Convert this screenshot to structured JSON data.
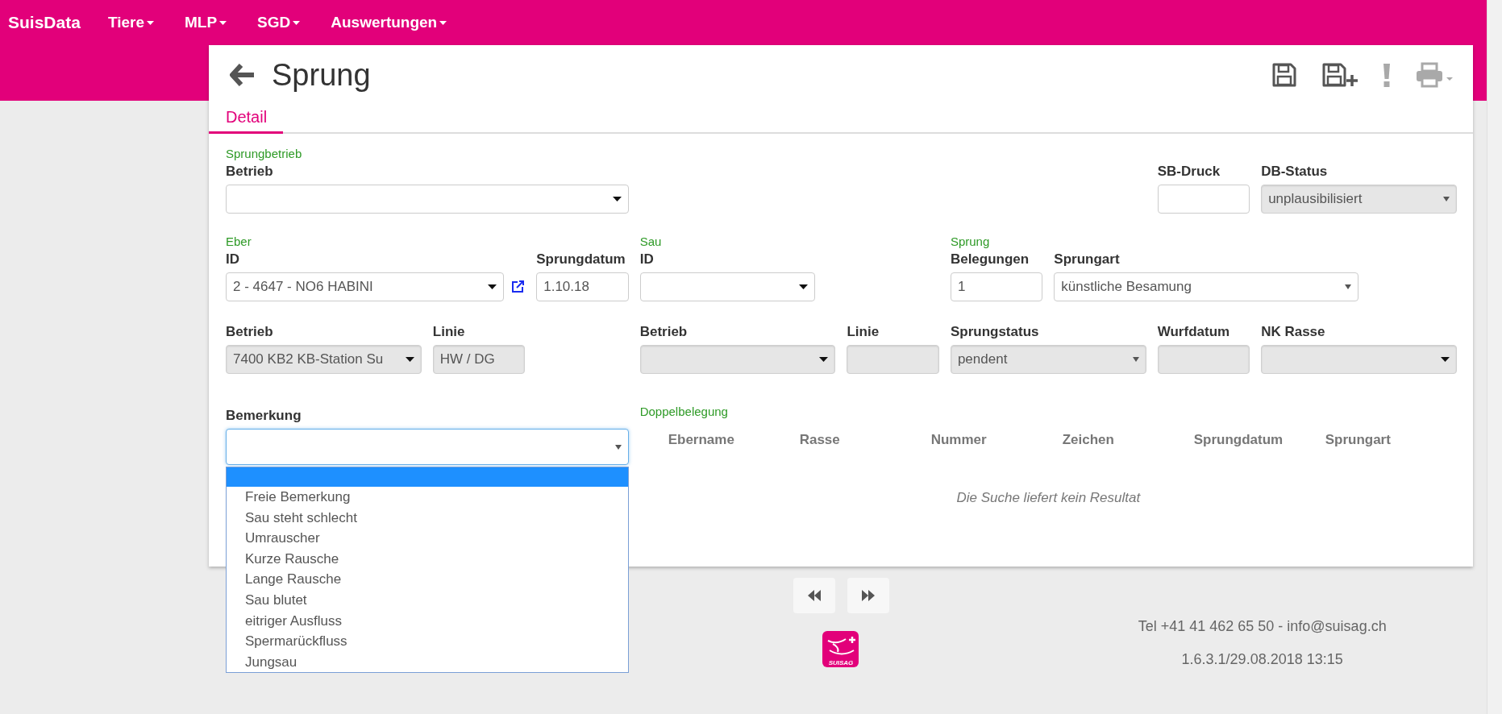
{
  "nav": {
    "brand": "SuisData",
    "menus": [
      {
        "label": "Tiere"
      },
      {
        "label": "MLP"
      },
      {
        "label": "SGD"
      },
      {
        "label": "Auswertungen"
      }
    ]
  },
  "page": {
    "title": "Sprung",
    "toolbar": [
      {
        "kind": "save",
        "disabled": false
      },
      {
        "kind": "save-new",
        "disabled": false
      },
      {
        "kind": "alert",
        "disabled": true
      },
      {
        "kind": "print",
        "disabled": true
      }
    ],
    "tabs": [
      {
        "label": "Detail",
        "selected": true
      }
    ]
  },
  "form": {
    "headings": [
      {
        "label": "Sprungbetrieb"
      },
      {
        "label": "Eber"
      },
      {
        "label": "Sau"
      },
      {
        "label": "Sprung"
      }
    ],
    "fields": [
      {
        "label": "Betrieb",
        "kind": "select",
        "disabled": false
      },
      {
        "label": "SB-Druck",
        "kind": "input",
        "disabled": false
      },
      {
        "label": "DB-Status",
        "kind": "native-select",
        "disabled": true,
        "value": "unplausibilisiert"
      },
      {
        "label": "ID",
        "kind": "select",
        "disabled": false,
        "value": "2 - 4647 - NO6 HABINI",
        "link": true
      },
      {
        "label": "Sprungdatum",
        "kind": "input",
        "disabled": false,
        "value": "1.10.18"
      },
      {
        "label": "ID",
        "kind": "select",
        "disabled": false
      },
      {
        "label": "Belegungen",
        "kind": "input",
        "disabled": false,
        "value": "1"
      },
      {
        "label": "Sprungart",
        "kind": "native-select",
        "disabled": false,
        "value": "künstliche Besamung"
      },
      {
        "label": "Betrieb",
        "kind": "select",
        "disabled": true,
        "value": "7400 KB2 KB-Station Su"
      },
      {
        "label": "Linie",
        "kind": "input",
        "disabled": true,
        "value": "HW / DG"
      },
      {
        "label": "Betrieb",
        "kind": "select",
        "disabled": true
      },
      {
        "label": "Linie",
        "kind": "input",
        "disabled": true
      },
      {
        "label": "Sprungstatus",
        "kind": "native-select",
        "disabled": true,
        "value": "pendent"
      },
      {
        "label": "Wurfdatum",
        "kind": "input",
        "disabled": true
      },
      {
        "label": "NK Rasse",
        "kind": "select",
        "disabled": true
      },
      {
        "label": "Bemerkung",
        "kind": "native-select",
        "disabled": false,
        "focused": true,
        "dropdown": {
          "open": true,
          "blank_highlighted": true,
          "options": [
            {
              "label": "Freie Bemerkung",
              "selected": false
            },
            {
              "label": "Sau steht schlecht",
              "selected": false
            },
            {
              "label": "Umrauscher",
              "selected": false
            },
            {
              "label": "Kurze Rausche",
              "selected": false
            },
            {
              "label": "Lange Rausche",
              "selected": false
            },
            {
              "label": "Sau blutet",
              "selected": false
            },
            {
              "label": "eitriger Ausfluss",
              "selected": false
            },
            {
              "label": "Spermarückfluss",
              "selected": false
            },
            {
              "label": "Jungsau",
              "selected": false
            }
          ]
        }
      }
    ]
  },
  "doppelbelegung": {
    "heading": "Doppelbelegung",
    "columns": [
      "Ebername",
      "Rasse",
      "Nummer",
      "Zeichen",
      "Sprungdatum",
      "Sprungart"
    ],
    "empty_message": "Die Suche liefert kein Resultat"
  },
  "pager": [
    {
      "kind": "previous"
    },
    {
      "kind": "next"
    }
  ],
  "footer": {
    "logo_text": "SUISAG",
    "contact": "Tel +41 41 462 65 50 - info@suisag.ch",
    "version": "1.6.3.1/29.08.2018 13:15"
  }
}
